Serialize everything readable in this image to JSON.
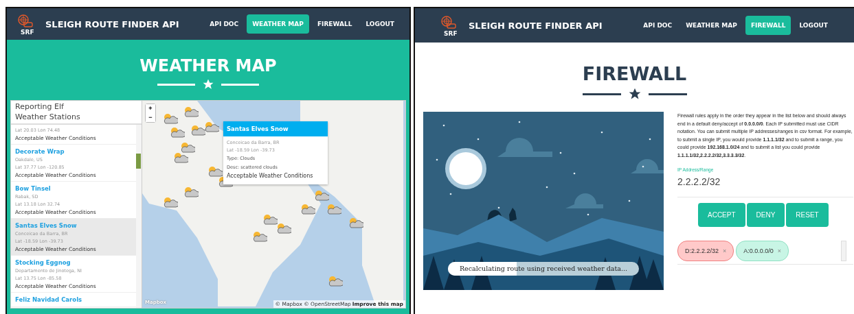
{
  "left_screen": {
    "brand": {
      "logo_text": "SRF",
      "title": "SLEIGH ROUTE FINDER API"
    },
    "nav": [
      {
        "label": "API DOC",
        "selected": false
      },
      {
        "label": "WEATHER MAP",
        "selected": true
      },
      {
        "label": "FIREWALL",
        "selected": false
      },
      {
        "label": "LOGOUT",
        "selected": false
      }
    ],
    "page_title": "WEATHER MAP",
    "sidebar": {
      "title_lines": [
        "Reporting Elf",
        "Weather Stations"
      ],
      "stations": [
        {
          "coords": "Lat 20.03 Lon 74.48",
          "conditions": "Acceptable Weather Conditions",
          "selected": false
        },
        {
          "name": "Decorate Wrap",
          "location": "Oakdale, US",
          "coords": "Lat 37.77 Lon -120.85",
          "conditions": "Acceptable Weather Conditions",
          "selected": false
        },
        {
          "name": "Bow Tinsel",
          "location": "Rabak, SD",
          "coords": "Lat 13.18 Lon 32.74",
          "conditions": "Acceptable Weather Conditions",
          "selected": false
        },
        {
          "name": "Santas Elves Snow",
          "location": "Conceicao da Barra, BR",
          "coords": "Lat -18.59 Lon -39.73",
          "conditions": "Acceptable Weather Conditions",
          "selected": true
        },
        {
          "name": "Stocking Eggnog",
          "location": "Departamento de Jinotega, NI",
          "coords": "Lat 13.75 Lon -85.58",
          "conditions": "Acceptable Weather Conditions",
          "selected": false
        },
        {
          "name": "Feliz Navidad Carols",
          "selected": false
        }
      ]
    },
    "map": {
      "zoom_in": "+",
      "zoom_out": "−",
      "popup": {
        "title": "Santas Elves Snow",
        "location": "Conceicao da Barra, BR",
        "coords": "Lat -18.59 Lon -39.73",
        "type": "Type: Clouds",
        "desc": "Desc: scattered clouds",
        "conditions": "Acceptable Weather Conditions"
      },
      "logo": "Mapbox",
      "attribution": "© Mapbox © OpenStreetMap",
      "improve_link": "Improve this map"
    }
  },
  "right_screen": {
    "brand": {
      "logo_text": "SRF",
      "title": "SLEIGH ROUTE FINDER API"
    },
    "nav": [
      {
        "label": "API DOC",
        "selected": false
      },
      {
        "label": "WEATHER MAP",
        "selected": false
      },
      {
        "label": "FIREWALL",
        "selected": true
      },
      {
        "label": "LOGOUT",
        "selected": false
      }
    ],
    "page_title": "FIREWALL",
    "status": {
      "text": "Recalculating route using received weather data...",
      "level": 0.36
    },
    "description": "Firewall rules apply in the order they appear in the list below and should always end in a default deny/accept of **0.0.0.0/0**. Each IP submitted must use CIDR notation. You can submit multiple IP addresses/ranges in csv format. For example, to submit a single IP, you would provide **1.1.1.1/32** and to submit a range, you could provide **192.168.1.0/24** and to submit a list you could provide **1.1.1.1/32,2.2.2.2/32,3.3.3.3/32**.",
    "ip_field": {
      "label": "IP Address/Range",
      "value": "2.2.2.2/32"
    },
    "buttons": [
      "ACCEPT",
      "DENY",
      "RESET"
    ],
    "rules": [
      {
        "label": "D:2.2.2.2/32",
        "kind": "deny",
        "remove": "×"
      },
      {
        "label": "A:0.0.0.0/0",
        "kind": "accept",
        "remove": "×"
      }
    ]
  }
}
